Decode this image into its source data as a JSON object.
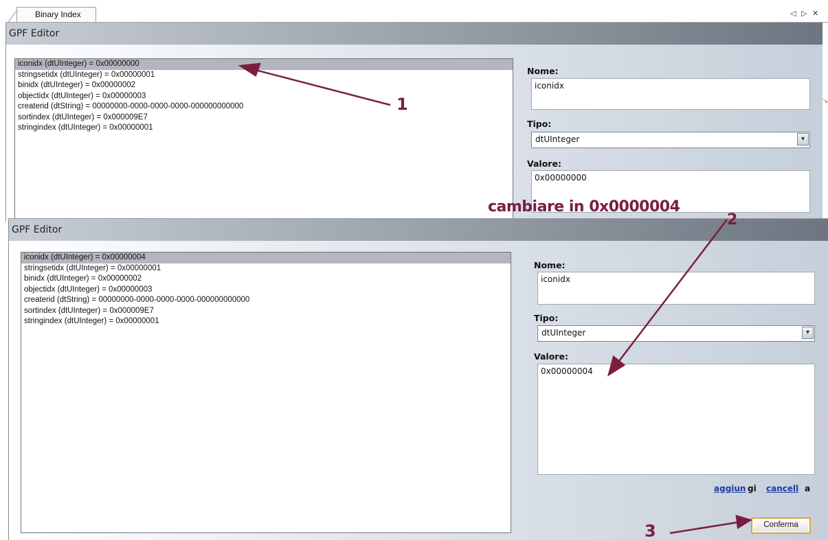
{
  "tab": {
    "label": "Binary Index",
    "controls": [
      "◁",
      "▷",
      "✕"
    ]
  },
  "editor_top": {
    "title": "GPF Editor",
    "list": [
      "iconidx (dtUInteger) = 0x00000000",
      "stringsetidx (dtUInteger) = 0x00000001",
      "binidx (dtUInteger) = 0x00000002",
      "objectidx (dtUInteger) = 0x00000003",
      "createrid (dtString) = 00000000-0000-0000-0000-000000000000",
      "sortindex (dtUInteger) = 0x000009E7",
      "stringindex (dtUInteger) = 0x00000001"
    ],
    "nome_label": "Nome:",
    "nome_value": "iconidx",
    "tipo_label": "Tipo:",
    "tipo_value": "dtUInteger",
    "valore_label": "Valore:",
    "valore_value": "0x00000000"
  },
  "editor_bottom": {
    "title": "GPF Editor",
    "list": [
      "iconidx (dtUInteger) = 0x00000004",
      "stringsetidx (dtUInteger) = 0x00000001",
      "binidx (dtUInteger) = 0x00000002",
      "objectidx (dtUInteger) = 0x00000003",
      "createrid (dtString) = 00000000-0000-0000-0000-000000000000",
      "sortindex (dtUInteger) = 0x000009E7",
      "stringindex (dtUInteger) = 0x00000001"
    ],
    "nome_label": "Nome:",
    "nome_value": "iconidx",
    "tipo_label": "Tipo:",
    "tipo_value": "dtUInteger",
    "valore_label": "Valore:",
    "valore_value": "0x00000004",
    "link_add": "aggiun",
    "link_add_tail": "gi",
    "link_cancel": "cancell",
    "link_cancel_tail": "a",
    "confirm_label": "Conferma"
  },
  "annotations": {
    "step1": "1",
    "step2": "2",
    "step3": "3",
    "instruction": "cambiare in 0x0000004"
  },
  "colors": {
    "annotation": "#7a1e40",
    "link": "#1c3aa8",
    "button_border": "#d9a33c"
  }
}
